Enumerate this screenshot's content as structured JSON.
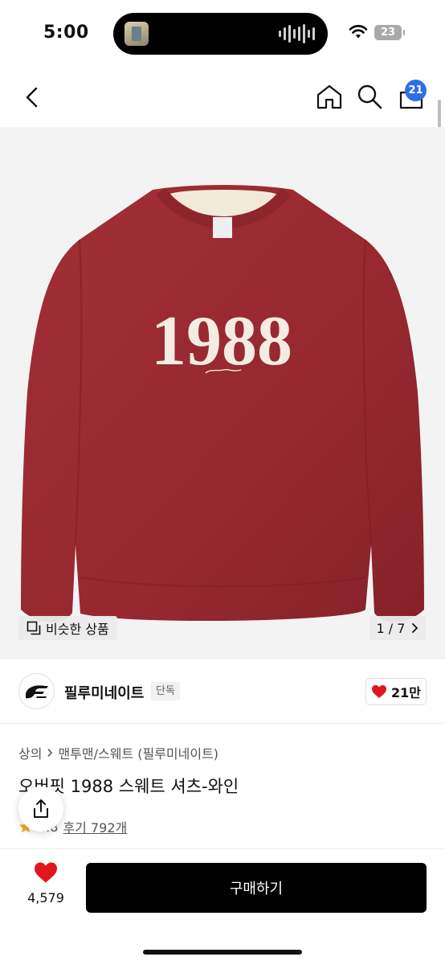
{
  "status_bar": {
    "time": "5:00",
    "battery": "23"
  },
  "nav": {
    "cart_count": "21"
  },
  "gallery": {
    "similar_label": "비슷한 상품",
    "pager": "1 / 7",
    "print_text": "1988"
  },
  "brand": {
    "name": "필루미네이트",
    "tag": "단독",
    "like_count": "21만"
  },
  "product": {
    "breadcrumb_1": "상의",
    "breadcrumb_2": "맨투맨/스웨트 (필루미네이트)",
    "title": "오버핏 1988 스웨트 셔츠-와인",
    "rating": "4.8",
    "reviews": "후기 792개"
  },
  "bottom": {
    "heart_count": "4,579",
    "buy_label": "구매하기"
  },
  "colors": {
    "sweater": "#9a2a31",
    "accent_badge": "#2f6fe6",
    "heart": "#e0161c",
    "buy_button": "#000000"
  }
}
